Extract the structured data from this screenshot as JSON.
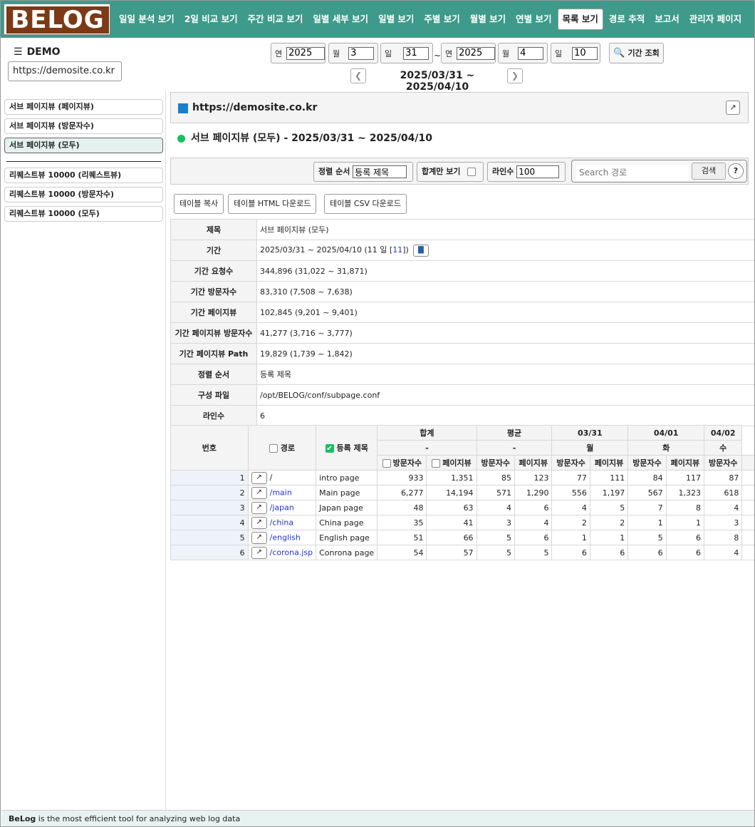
{
  "logo": {
    "text": "BELOG"
  },
  "nav": [
    "일일 분석 보기",
    "2일 비교 보기",
    "주간 비교 보기",
    "일별 세부 보기",
    "일별 보기",
    "주별 보기",
    "월별 보기",
    "연별 보기",
    "목록 보기",
    "경로 추적",
    "보고서",
    "관리자 페이지"
  ],
  "nav_active": "목록 보기",
  "site": {
    "name": "DEMO",
    "url": "https://demosite.co.kr"
  },
  "date": {
    "y_label": "연",
    "m_label": "월",
    "d_label": "일",
    "from_y": "2025",
    "from_m": "3",
    "from_d": "31",
    "to_y": "2025",
    "to_m": "4",
    "to_d": "10",
    "tilde": "~",
    "search_label": "기간 조회",
    "period": "2025/03/31 ~ 2025/04/10"
  },
  "sidebar": {
    "items": [
      "서브 페이지뷰 (페이지뷰)",
      "서브 페이지뷰 (방문자수)",
      "서브 페이지뷰 (모두)",
      "리퀘스트뷰 10000 (리퀘스트뷰)",
      "리퀘스트뷰 10000 (방문자수)",
      "리퀘스트뷰 10000 (모두)"
    ]
  },
  "main": {
    "site_url": "https://demosite.co.kr",
    "report_title": "서브 페이지뷰 (모두) - 2025/03/31 ~ 2025/04/10"
  },
  "filters": {
    "sort_label": "정렬 순서",
    "sort_value": "등록 제목",
    "total_only_label": "합계만 보기",
    "lines_label": "라인수",
    "lines_value": "100",
    "search_placeholder": "Search 경로",
    "search_btn": "검색",
    "help": "?"
  },
  "buttons": {
    "copy": "테이블 복사",
    "html": "테이블 HTML 다운로드",
    "csv": "테이블 CSV 다운로드"
  },
  "info": [
    {
      "k": "제목",
      "v": "서브 페이지뷰 (모두)"
    },
    {
      "k": "기간",
      "v": "2025/03/31 ~ 2025/04/10 (11 일 [",
      "link": "11",
      "after": "])"
    },
    {
      "k": "기간 요청수",
      "v": "344,896 (31,022 ~ 31,871)"
    },
    {
      "k": "기간 방문자수",
      "v": "83,310 (7,508 ~ 7,638)"
    },
    {
      "k": "기간 페이지뷰",
      "v": "102,845 (9,201 ~ 9,401)"
    },
    {
      "k": "기간 페이지뷰 방문자수",
      "v": "41,277 (3,716 ~ 3,777)"
    },
    {
      "k": "기간 페이지뷰 Path",
      "v": "19,829 (1,739 ~ 1,842)"
    },
    {
      "k": "정렬 순서",
      "v": "등록 제목"
    },
    {
      "k": "구성 파일",
      "v": "/opt/BELOG/conf/subpage.conf"
    },
    {
      "k": "라인수",
      "v": "6"
    }
  ],
  "table": {
    "h_no": "번호",
    "h_path": "경로",
    "h_title": "등록 제목",
    "groups": [
      "합계",
      "평균",
      "03/31",
      "04/01",
      "04/02"
    ],
    "days": [
      "-",
      "-",
      "월",
      "화",
      "수"
    ],
    "visitors": "방문자수",
    "pageviews": "페이지뷰",
    "rows": [
      {
        "no": "1",
        "path": "/",
        "title": "intro page",
        "vals": [
          "933",
          "1,351",
          "85",
          "123",
          "77",
          "111",
          "84",
          "117",
          "87"
        ]
      },
      {
        "no": "2",
        "path": "/main",
        "title": "Main page",
        "vals": [
          "6,277",
          "14,194",
          "571",
          "1,290",
          "556",
          "1,197",
          "567",
          "1,323",
          "618"
        ]
      },
      {
        "no": "3",
        "path": "/japan",
        "title": "Japan page",
        "vals": [
          "48",
          "63",
          "4",
          "6",
          "4",
          "5",
          "7",
          "8",
          "4"
        ]
      },
      {
        "no": "4",
        "path": "/china",
        "title": "China page",
        "vals": [
          "35",
          "41",
          "3",
          "4",
          "2",
          "2",
          "1",
          "1",
          "3"
        ]
      },
      {
        "no": "5",
        "path": "/english",
        "title": "English page",
        "vals": [
          "51",
          "66",
          "5",
          "6",
          "1",
          "1",
          "5",
          "6",
          "8"
        ]
      },
      {
        "no": "6",
        "path": "/corona.jsp",
        "title": "Conrona page",
        "vals": [
          "54",
          "57",
          "5",
          "5",
          "6",
          "6",
          "6",
          "6",
          "4"
        ]
      }
    ]
  },
  "footer": {
    "brand": "BeLog",
    "text": " is the most efficient tool for analyzing web log data"
  }
}
